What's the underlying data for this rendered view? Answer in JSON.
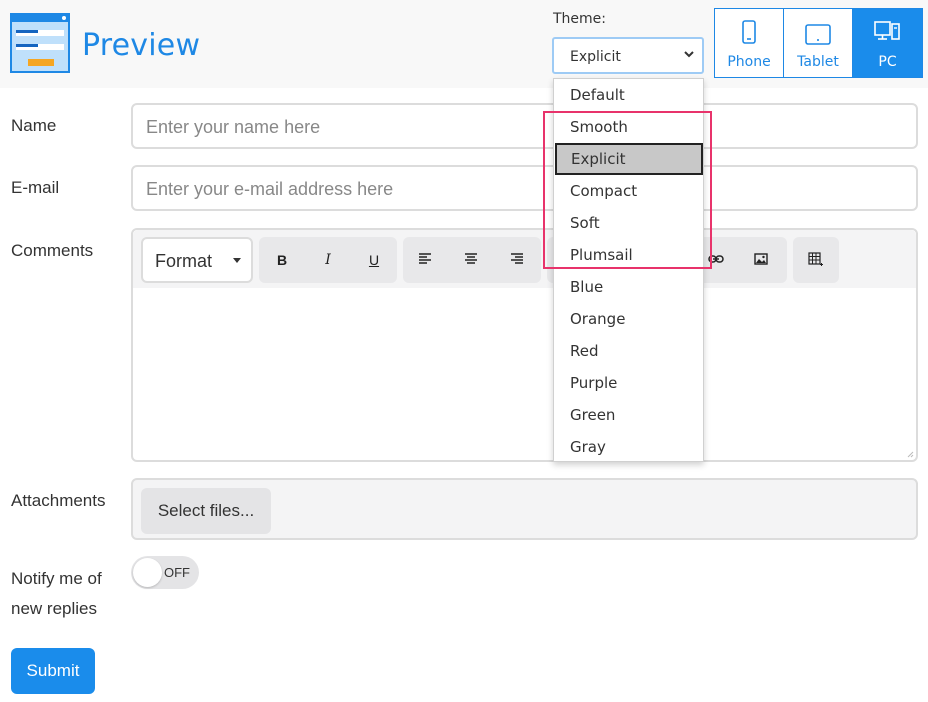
{
  "header": {
    "title": "Preview",
    "theme_label": "Theme:",
    "theme_value": "Explicit",
    "devices": [
      {
        "label": "Phone",
        "icon": "phone-icon",
        "active": false
      },
      {
        "label": "Tablet",
        "icon": "tablet-icon",
        "active": false
      },
      {
        "label": "PC",
        "icon": "pc-icon",
        "active": true
      }
    ]
  },
  "form": {
    "name": {
      "label": "Name",
      "placeholder": "Enter your name here"
    },
    "email": {
      "label": "E-mail",
      "placeholder": "Enter your e-mail address here"
    },
    "comments": {
      "label": "Comments",
      "format_value": "Format",
      "bold": "B",
      "italic": "I",
      "underline": "U"
    },
    "attachments": {
      "label": "Attachments",
      "button": "Select files..."
    },
    "notify": {
      "label_line1": "Notify me of",
      "label_line2": "new replies",
      "toggle_text": "OFF"
    },
    "submit": "Submit"
  },
  "theme_dropdown": {
    "options": [
      "Default",
      "Smooth",
      "Explicit",
      "Compact",
      "Soft",
      "Plumsail",
      "Blue",
      "Orange",
      "Red",
      "Purple",
      "Green",
      "Gray"
    ],
    "selected": "Explicit"
  },
  "colors": {
    "accent": "#1a8ceb",
    "highlight": "#e8336b"
  }
}
